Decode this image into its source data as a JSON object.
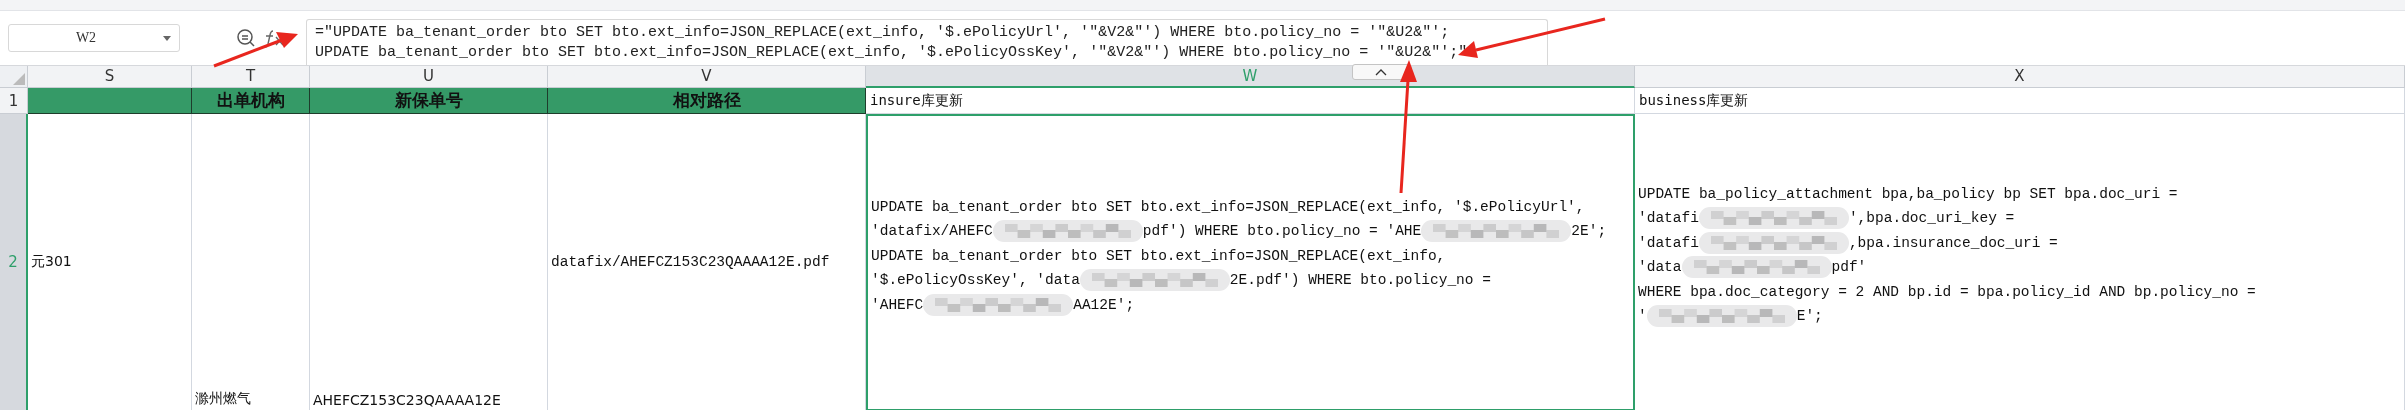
{
  "name_box": {
    "value": "W2"
  },
  "formula_bar": {
    "lines": [
      "=\"UPDATE ba_tenant_order bto SET bto.ext_info=JSON_REPLACE(ext_info, '$.ePolicyUrl', '\"&V2&\"') WHERE bto.policy_no = '\"&U2&\"';",
      "UPDATE ba_tenant_order bto SET bto.ext_info=JSON_REPLACE(ext_info, '$.ePolicyOssKey', '\"&V2&\"') WHERE bto.policy_no = '\"&U2&\"';\""
    ]
  },
  "columns": [
    {
      "label": "S",
      "selected": false
    },
    {
      "label": "T",
      "selected": false
    },
    {
      "label": "U",
      "selected": false
    },
    {
      "label": "V",
      "selected": false
    },
    {
      "label": "W",
      "selected": true
    },
    {
      "label": "X",
      "selected": false
    }
  ],
  "rows": [
    {
      "number": "1",
      "selected": false,
      "cells": [
        {
          "kind": "header",
          "text": ""
        },
        {
          "kind": "header",
          "text": "出单机构"
        },
        {
          "kind": "header",
          "text": "新保单号"
        },
        {
          "kind": "header",
          "text": "相对路径"
        },
        {
          "kind": "plain",
          "text": "insure库更新",
          "selected": false
        },
        {
          "kind": "plain",
          "text": "business库更新",
          "selected": false
        }
      ]
    },
    {
      "number": "2",
      "selected": true,
      "cells": [
        {
          "kind": "middle",
          "text": "元301"
        },
        {
          "kind": "bottom",
          "text": "滁州燃气"
        },
        {
          "kind": "bottom",
          "text": "AHEFCZ153C23QAAAA12E"
        },
        {
          "kind": "middle",
          "text": "datafix/AHEFCZ153C23QAAAA12E.pdf"
        },
        {
          "kind": "sql",
          "selected": true,
          "lines": [
            [
              {
                "text": "UPDATE ba_tenant_order bto SET bto.ext_info=JSON_REPLACE(ext_info, '$.ePolicyUrl',"
              }
            ],
            [
              {
                "text": "'datafix/AHEFC"
              },
              {
                "kind": "redacted"
              },
              {
                "text": "pdf') WHERE bto.policy_no = 'AHE"
              },
              {
                "kind": "redacted"
              },
              {
                "text": "2E';"
              }
            ],
            [
              {
                "text": "UPDATE ba_tenant_order bto SET bto.ext_info=JSON_REPLACE(ext_info,"
              }
            ],
            [
              {
                "text": "'$.ePolicyOssKey', 'data"
              },
              {
                "kind": "redacted"
              },
              {
                "text": "2E.pdf') WHERE bto.policy_no ="
              }
            ],
            [
              {
                "text": "'AHEFC"
              },
              {
                "kind": "redacted"
              },
              {
                "text": "AA12E';"
              }
            ]
          ]
        },
        {
          "kind": "sql",
          "selected": false,
          "lines": [
            [
              {
                "text": "UPDATE ba_policy_attachment bpa,ba_policy bp SET bpa.doc_uri ="
              }
            ],
            [
              {
                "text": "'datafi"
              },
              {
                "kind": "redacted"
              },
              {
                "text": "',bpa.doc_uri_key ="
              }
            ],
            [
              {
                "text": "'datafi"
              },
              {
                "kind": "redacted"
              },
              {
                "text": ",bpa.insurance_doc_uri ="
              }
            ],
            [
              {
                "text": "'data"
              },
              {
                "kind": "redacted"
              },
              {
                "text": "pdf'"
              }
            ],
            [
              {
                "text": "WHERE bpa.doc_category = 2 AND bp.id = bpa.policy_id AND bp.policy_no ="
              }
            ],
            [
              {
                "text": "'"
              },
              {
                "kind": "redacted"
              },
              {
                "text": "E';"
              }
            ]
          ]
        }
      ]
    }
  ]
}
